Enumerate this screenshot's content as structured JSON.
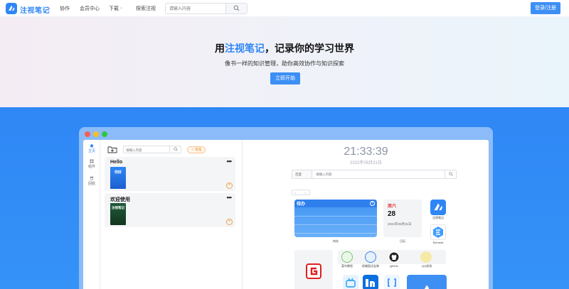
{
  "header": {
    "brand": "注视笔记",
    "nav": [
      "协作",
      "会员中心",
      "下载",
      "探索注视"
    ],
    "search_placeholder": "请输入内容",
    "login_label": "登录/注册"
  },
  "hero": {
    "title_prefix": "用",
    "title_highlight": "注视笔记",
    "title_suffix": "，记录你的学习世界",
    "subtitle": "像书一样的知识管理，助你高效协作与知识探索",
    "cta_label": "立即开始"
  },
  "app": {
    "sidebar": [
      {
        "label": "主页",
        "icon": "home-icon"
      },
      {
        "label": "组件",
        "icon": "grid-icon"
      },
      {
        "label": "回收",
        "icon": "trash-icon"
      }
    ],
    "notes": {
      "search_placeholder": "请输入内容",
      "tag_label": "☆ 管理",
      "cards": [
        {
          "title": "Hello",
          "book_text": "你好",
          "more": "•••"
        },
        {
          "title": "欢迎使用",
          "book_text": "注视笔记",
          "more": "•••"
        }
      ]
    },
    "dashboard": {
      "time": "21:33:39",
      "date": "2022年05月31日",
      "engine": "百度",
      "search_placeholder": "请输入内容",
      "pager": [
        "<",
        ">"
      ],
      "todo": {
        "title": "待办",
        "caption": "待办"
      },
      "calendar": {
        "weekday": "周六",
        "day": "28",
        "full_date": "2022年05月31日",
        "caption": "日历"
      },
      "apps": [
        {
          "name": "注视笔记"
        },
        {
          "name": "Element"
        },
        {
          "name": "菜鸟教程"
        },
        {
          "name": "前端面试宝典"
        },
        {
          "name": "gitHub"
        },
        {
          "name": "QQ农场"
        }
      ]
    }
  }
}
